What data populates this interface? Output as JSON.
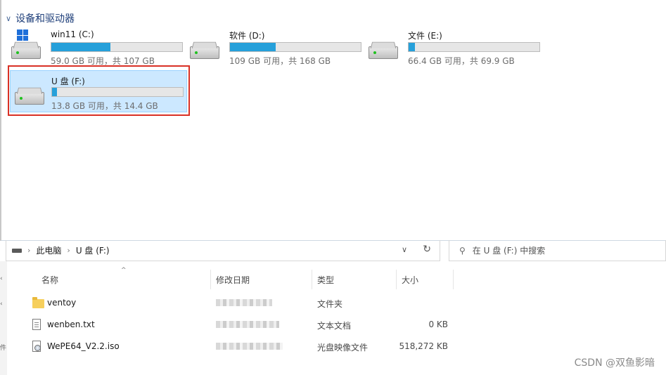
{
  "top_pane": {
    "section_title": "设备和驱动器",
    "drives": [
      {
        "name": "win11 (C:)",
        "capacity": "59.0 GB 可用，共 107 GB",
        "used_fraction": 0.45,
        "icon": "windows-drive-icon",
        "selected": false
      },
      {
        "name": "软件 (D:)",
        "capacity": "109 GB 可用，共 168 GB",
        "used_fraction": 0.35,
        "icon": "hard-drive-icon",
        "selected": false
      },
      {
        "name": "文件 (E:)",
        "capacity": "66.4 GB 可用，共 69.9 GB",
        "used_fraction": 0.05,
        "icon": "hard-drive-icon",
        "selected": false
      },
      {
        "name": "U 盘 (F:)",
        "capacity": "13.8 GB 可用，共 14.4 GB",
        "used_fraction": 0.04,
        "icon": "usb-drive-icon",
        "selected": true
      }
    ],
    "highlight_color": "#d93025",
    "bar_color": "#26a0da"
  },
  "address_bar": {
    "crumbs": [
      "此电脑",
      "U 盘 (F:)"
    ],
    "dropdown_icon": "chevron-down-icon",
    "refresh_icon": "refresh-icon"
  },
  "search": {
    "placeholder": "在 U 盘 (F:) 中搜索",
    "icon": "search-icon"
  },
  "file_list": {
    "columns": [
      "名称",
      "修改日期",
      "类型",
      "大小"
    ],
    "rows": [
      {
        "name": "ventoy",
        "type": "文件夹",
        "size": "",
        "icon": "folder-icon"
      },
      {
        "name": "wenben.txt",
        "type": "文本文档",
        "size": "0 KB",
        "icon": "text-file-icon"
      },
      {
        "name": "WePE64_V2.2.iso",
        "type": "光盘映像文件",
        "size": "518,272 KB",
        "icon": "disc-image-icon"
      }
    ]
  },
  "watermark": "CSDN @双鱼影暗"
}
